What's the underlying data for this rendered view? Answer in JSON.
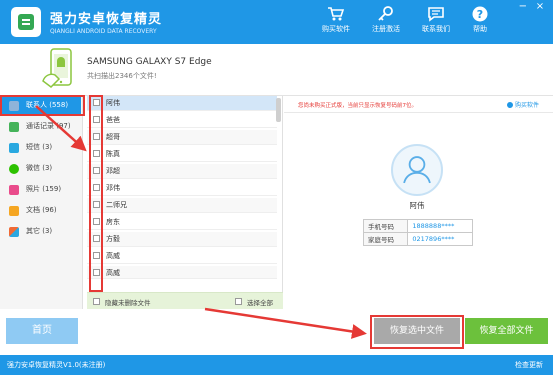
{
  "app": {
    "title": "强力安卓恢复精灵",
    "subtitle": "QIANGLI ANDROID DATA RECOVERY"
  },
  "toolbar": {
    "buy": "购买软件",
    "register": "注册激活",
    "contact": "联系我们",
    "help": "帮助"
  },
  "window_controls": {
    "minimize": "−",
    "close": "×"
  },
  "device": {
    "name": "SAMSUNG GALAXY S7 Edge",
    "scan_summary": "共扫描出2346个文件!"
  },
  "categories": [
    {
      "label": "联系人 (558)",
      "icon": "contacts-icon",
      "color": "#8fb4d9"
    },
    {
      "label": "通话记录 (97)",
      "icon": "phone-icon",
      "color": "#45b35a"
    },
    {
      "label": "短信 (3)",
      "icon": "sms-icon",
      "color": "#29a8e0"
    },
    {
      "label": "微信 (3)",
      "icon": "wechat-icon",
      "color": "#2dc100"
    },
    {
      "label": "照片 (159)",
      "icon": "photo-icon",
      "color": "#e94b8b"
    },
    {
      "label": "文档 (96)",
      "icon": "document-icon",
      "color": "#f5a623"
    },
    {
      "label": "其它 (3)",
      "icon": "other-icon",
      "color": "#f06a35"
    }
  ],
  "contacts": [
    "阿伟",
    "爸爸",
    "超哥",
    "陈真",
    "邓超",
    "邓伟",
    "二师兄",
    "房东",
    "方毅",
    "高威",
    "高威"
  ],
  "list_footer": {
    "hide_deleted": "隐藏未删除文件",
    "select_all": "选择全部"
  },
  "detail": {
    "notice": "您尚未购买正式版，当前只显示恢复号码前7位。",
    "buy_link": "购买软件",
    "name": "阿伟",
    "phones": [
      {
        "label": "手机号码",
        "value": "1888888****"
      },
      {
        "label": "家庭号码",
        "value": "0217896****"
      }
    ]
  },
  "buttons": {
    "home": "首页",
    "recover_selected": "恢复选中文件",
    "recover_all": "恢复全部文件"
  },
  "status": {
    "text": "强力安卓恢复精灵V1.0(未注册)",
    "update": "检查更新"
  },
  "colors": {
    "primary": "#1f97e6",
    "accent_green": "#6cc13c",
    "annotation_red": "#e53935"
  }
}
